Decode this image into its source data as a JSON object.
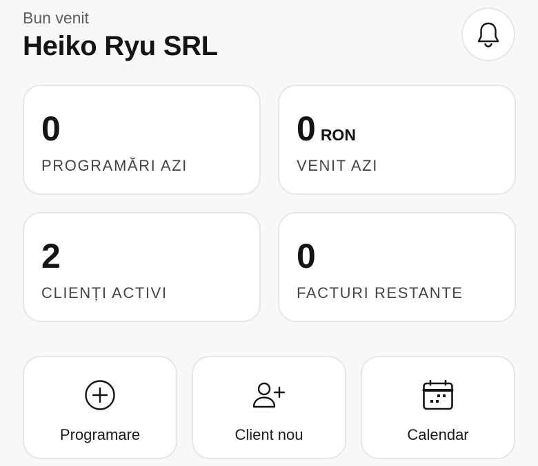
{
  "header": {
    "greeting": "Bun venit",
    "company": "Heiko Ryu SRL",
    "notifications_icon": "bell-icon"
  },
  "stats": [
    {
      "value": "0",
      "unit": "",
      "label": "PROGRAMĂRI AZI"
    },
    {
      "value": "0",
      "unit": "RON",
      "label": "VENIT AZI"
    },
    {
      "value": "2",
      "unit": "",
      "label": "CLIENȚI ACTIVI"
    },
    {
      "value": "0",
      "unit": "",
      "label": "FACTURI RESTANTE"
    }
  ],
  "actions": [
    {
      "label": "Programare",
      "icon": "plus-circle-icon"
    },
    {
      "label": "Client nou",
      "icon": "user-plus-icon"
    },
    {
      "label": "Calendar",
      "icon": "calendar-icon"
    }
  ]
}
